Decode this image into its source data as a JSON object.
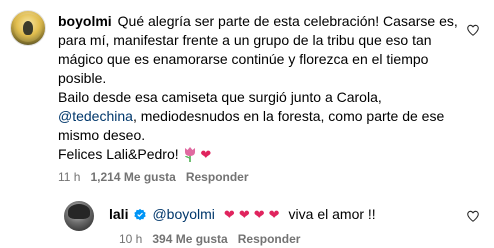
{
  "comment": {
    "username": "boyolmi",
    "lines": [
      "Qué alegría ser parte de esta celebración! Casarse es,",
      "para mí, manifestar frente a un grupo de la tribu que eso tan",
      "mágico que es enamorarse continúe y florezca en el tiempo",
      "posible."
    ],
    "line5_before": "Bailo desde esa camiseta que surgió junto a Carola,",
    "mention": "@tedechina",
    "line6_after": ", mediodesnudos en la foresta, como parte de ese",
    "line7": "mismo deseo.",
    "line8": "Felices Lali&Pedro!",
    "emojis": [
      "tulip",
      "heart"
    ],
    "time": "11 h",
    "likes": "1,214 Me gusta",
    "reply_label": "Responder"
  },
  "reply": {
    "username": "lali",
    "verified": true,
    "mention": "@boyolmi",
    "hearts": [
      "❤",
      "❤",
      "❤",
      "❤"
    ],
    "text": "viva el amor !!",
    "time": "10 h",
    "likes": "394 Me gusta",
    "reply_label": "Responder"
  },
  "colors": {
    "link": "#00376b",
    "meta": "#737373",
    "heart": "#e0245e",
    "verified": "#0095f6"
  }
}
